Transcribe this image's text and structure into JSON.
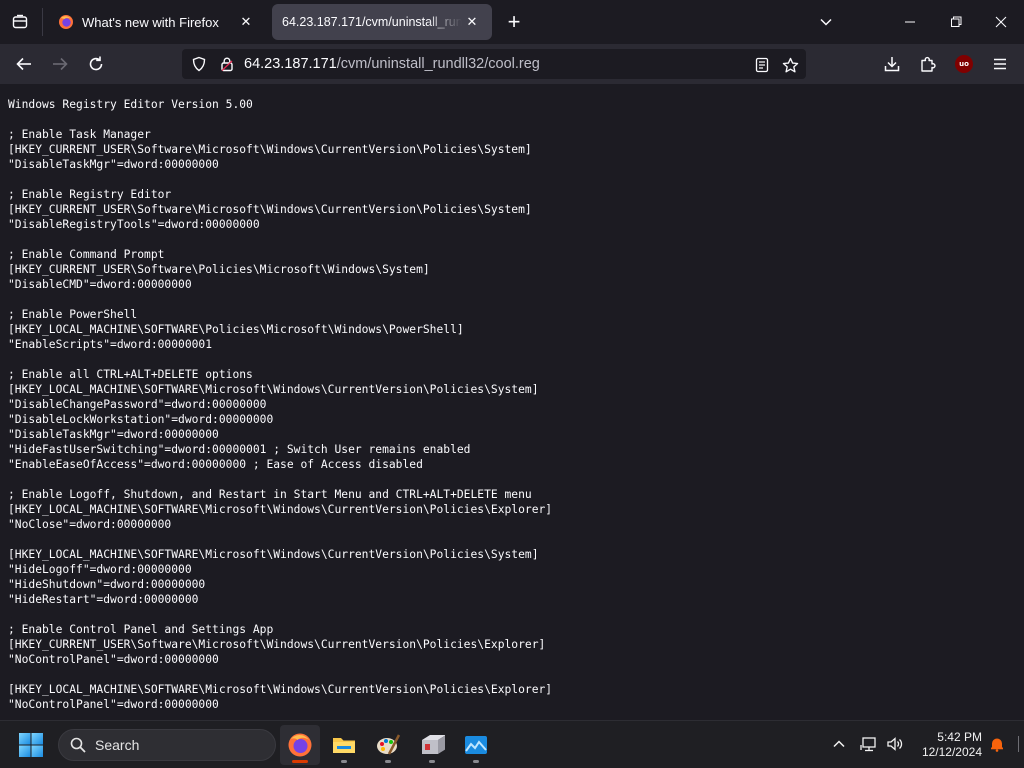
{
  "browser": {
    "tabs": [
      {
        "title": "What's new with Firefox",
        "active": false
      },
      {
        "title": "64.23.187.171/cvm/uninstall_rundll32/cool.reg",
        "active": true
      }
    ],
    "url": {
      "host": "64.23.187.171",
      "path": "/cvm/uninstall_rundll32/cool.reg"
    },
    "ublock_label": "uo"
  },
  "document": {
    "lines": [
      "Windows Registry Editor Version 5.00",
      "",
      "; Enable Task Manager",
      "[HKEY_CURRENT_USER\\Software\\Microsoft\\Windows\\CurrentVersion\\Policies\\System]",
      "\"DisableTaskMgr\"=dword:00000000",
      "",
      "; Enable Registry Editor",
      "[HKEY_CURRENT_USER\\Software\\Microsoft\\Windows\\CurrentVersion\\Policies\\System]",
      "\"DisableRegistryTools\"=dword:00000000",
      "",
      "; Enable Command Prompt",
      "[HKEY_CURRENT_USER\\Software\\Policies\\Microsoft\\Windows\\System]",
      "\"DisableCMD\"=dword:00000000",
      "",
      "; Enable PowerShell",
      "[HKEY_LOCAL_MACHINE\\SOFTWARE\\Policies\\Microsoft\\Windows\\PowerShell]",
      "\"EnableScripts\"=dword:00000001",
      "",
      "; Enable all CTRL+ALT+DELETE options",
      "[HKEY_LOCAL_MACHINE\\SOFTWARE\\Microsoft\\Windows\\CurrentVersion\\Policies\\System]",
      "\"DisableChangePassword\"=dword:00000000",
      "\"DisableLockWorkstation\"=dword:00000000",
      "\"DisableTaskMgr\"=dword:00000000",
      "\"HideFastUserSwitching\"=dword:00000001 ; Switch User remains enabled",
      "\"EnableEaseOfAccess\"=dword:00000000 ; Ease of Access disabled",
      "",
      "; Enable Logoff, Shutdown, and Restart in Start Menu and CTRL+ALT+DELETE menu",
      "[HKEY_LOCAL_MACHINE\\SOFTWARE\\Microsoft\\Windows\\CurrentVersion\\Policies\\Explorer]",
      "\"NoClose\"=dword:00000000",
      "",
      "[HKEY_LOCAL_MACHINE\\SOFTWARE\\Microsoft\\Windows\\CurrentVersion\\Policies\\System]",
      "\"HideLogoff\"=dword:00000000",
      "\"HideShutdown\"=dword:00000000",
      "\"HideRestart\"=dword:00000000",
      "",
      "; Enable Control Panel and Settings App",
      "[HKEY_CURRENT_USER\\Software\\Microsoft\\Windows\\CurrentVersion\\Policies\\Explorer]",
      "\"NoControlPanel\"=dword:00000000",
      "",
      "[HKEY_LOCAL_MACHINE\\SOFTWARE\\Microsoft\\Windows\\CurrentVersion\\Policies\\Explorer]",
      "\"NoControlPanel\"=dword:00000000"
    ]
  },
  "taskbar": {
    "search_label": "Search",
    "apps": [
      {
        "name": "firefox",
        "active": true
      },
      {
        "name": "file-explorer",
        "active": false
      },
      {
        "name": "paint",
        "active": false
      },
      {
        "name": "installer",
        "active": false
      },
      {
        "name": "photos",
        "active": false
      }
    ],
    "clock": {
      "time": "5:42 PM",
      "date": "12/12/2024"
    }
  },
  "colors": {
    "accent": "#d83b01",
    "content_bg": "#1c1b22",
    "toolbar_bg": "#2b2a33"
  }
}
